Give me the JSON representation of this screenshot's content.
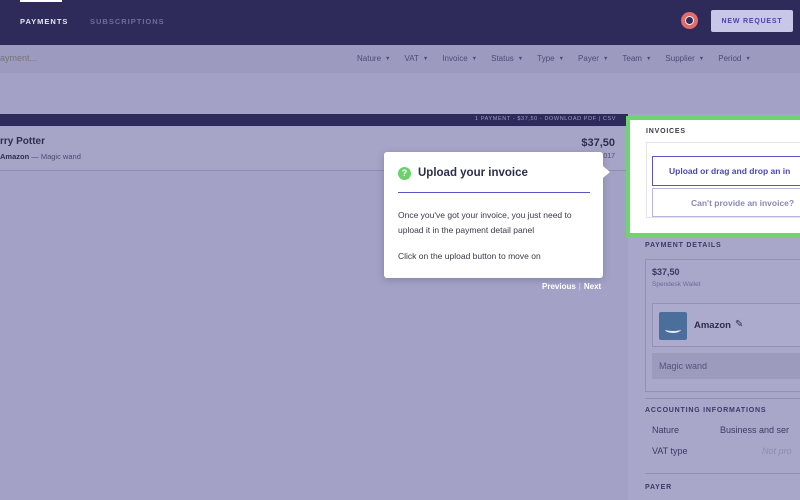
{
  "nav": {
    "tabs": [
      "PAYMENTS",
      "SUBSCRIPTIONS"
    ],
    "new_request_label": "NEW REQUEST",
    "help_icon": "lifebuoy-icon"
  },
  "search": {
    "placeholder": "ayment..."
  },
  "filters": [
    "Nature",
    "VAT",
    "Invoice",
    "Status",
    "Type",
    "Payer",
    "Team",
    "Supplier",
    "Period"
  ],
  "list": {
    "summary": "1 PAYMENT - $37,50 - DOWNLOAD PDF | CSV",
    "row": {
      "name": "rry Potter",
      "merchant": "Amazon",
      "separator": " — ",
      "description": "Magic wand",
      "amount": "$37,50",
      "date": "017"
    }
  },
  "invoices": {
    "label": "INVOICES",
    "upload_label": "Upload or drag and drop an in",
    "cant_label": "Can't provide an invoice?"
  },
  "payment_details": {
    "label": "PAYMENT DETAILS",
    "amount": "$37,50",
    "wallet": "Spendesk Wallet",
    "merchant": "Amazon",
    "description": "Magic wand"
  },
  "accounting": {
    "label": "ACCOUNTING INFORMATIONS",
    "nature_label": "Nature",
    "nature_value": "Business and ser",
    "vat_label": "VAT type",
    "vat_value": "Not pro"
  },
  "payer": {
    "label": "PAYER"
  },
  "tour": {
    "title": "Upload your invoice",
    "body": "Once you've got your invoice, you just need to upload it in the payment detail panel",
    "cta": "Click on the upload button to move on",
    "previous": "Previous",
    "separator": "|",
    "next": "Next"
  },
  "colors": {
    "nav_bg": "#2e2b5a",
    "accent": "#5a55c4",
    "highlight": "#6fd36f",
    "overlay": "#a3a2c6"
  }
}
